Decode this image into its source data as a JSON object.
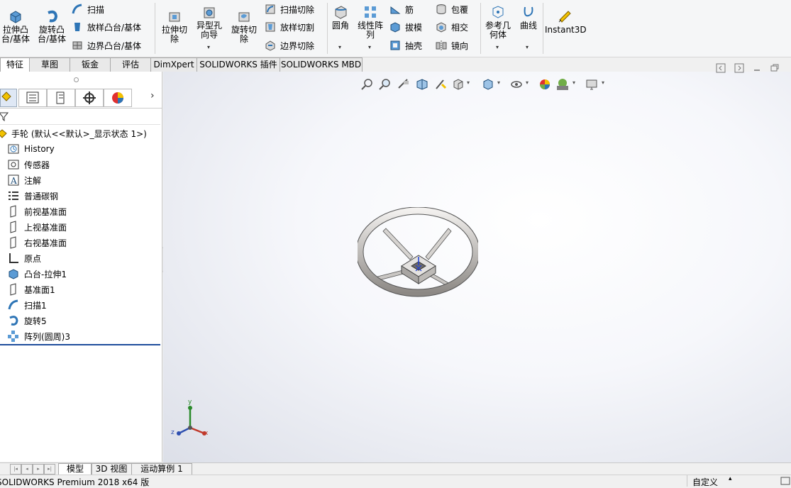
{
  "ribbon": {
    "extrude_boss": "拉伸凸\n台/基体",
    "revolve_boss": "旋转凸\n台/基体",
    "sweep": "扫描",
    "loft_boss": "放样凸台/基体",
    "boundary_boss": "边界凸台/基体",
    "extrude_cut": "拉伸切\n除",
    "hole_wizard": "异型孔\n向导",
    "revolve_cut": "旋转切\n除",
    "sweep_cut": "扫描切除",
    "loft_cut": "放样切割",
    "boundary_cut": "边界切除",
    "fillet": "圆角",
    "linear_pattern": "线性阵\n列",
    "rib": "筋",
    "draft": "拔模",
    "shell": "抽壳",
    "wrap": "包覆",
    "intersect": "相交",
    "mirror": "镜向",
    "ref_geometry": "参考几\n何体",
    "curves": "曲线",
    "instant3d": "Instant3D"
  },
  "tabs": [
    "特征",
    "草图",
    "钣金",
    "评估",
    "DimXpert",
    "SOLIDWORKS 插件",
    "SOLIDWORKS MBD"
  ],
  "tree": {
    "root": "手轮  (默认<<默认>_显示状态 1>)",
    "items": [
      "History",
      "传感器",
      "注解",
      "普通碳钢",
      "前视基准面",
      "上视基准面",
      "右视基准面",
      "原点",
      "凸台-拉伸1",
      "基准面1",
      "扫描1",
      "旋转5",
      "阵列(圆周)3"
    ]
  },
  "bottom_tabs": [
    "模型",
    "3D 视图",
    "运动算例 1"
  ],
  "status": {
    "left": "SOLIDWORKS Premium 2018 x64 版",
    "right": "自定义"
  },
  "triad": {
    "x": "x",
    "y": "y",
    "z": "z"
  }
}
